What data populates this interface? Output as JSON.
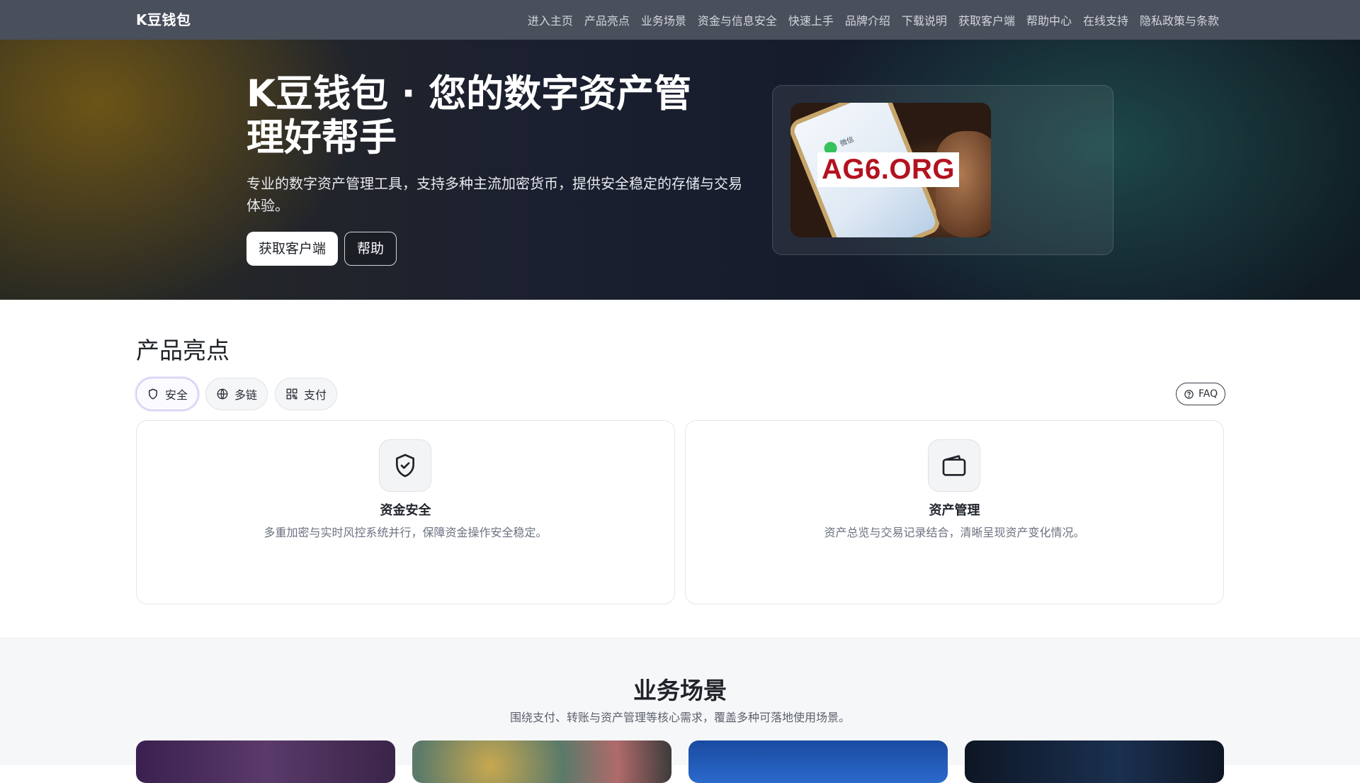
{
  "nav": {
    "brand": "K豆钱包",
    "links": [
      "进入主页",
      "产品亮点",
      "业务场景",
      "资金与信息安全",
      "快速上手",
      "品牌介绍",
      "下载说明",
      "获取客户端",
      "帮助中心",
      "在线支持",
      "隐私政策与条款"
    ]
  },
  "hero": {
    "title": "K豆钱包 · 您的数字资产管理好帮手",
    "subtitle": "专业的数字资产管理工具，支持多种主流加密货币，提供安全稳定的存储与交易体验。",
    "primary_button": "获取客户端",
    "secondary_button": "帮助",
    "image_watermark": "AG6.ORG",
    "phone_label": "微信"
  },
  "highlights": {
    "title": "产品亮点",
    "chips": [
      {
        "label": "安全",
        "icon": "shield-icon"
      },
      {
        "label": "多链",
        "icon": "globe-icon"
      },
      {
        "label": "支付",
        "icon": "qr-icon"
      }
    ],
    "faq_label": "FAQ",
    "features": [
      {
        "name": "资金安全",
        "desc": "多重加密与实时风控系统并行，保障资金操作安全稳定。",
        "icon": "shield-check-icon"
      },
      {
        "name": "资产管理",
        "desc": "资产总览与交易记录结合，清晰呈现资产变化情况。",
        "icon": "wallet-icon"
      }
    ]
  },
  "scenes": {
    "title": "业务场景",
    "subtitle": "围绕支付、转账与资产管理等核心需求，覆盖多种可落地使用场景。"
  },
  "colors": {
    "nav_bg": "#4a4f5c",
    "accent_chip_border": "#c9c2f3",
    "watermark_red": "#b3121f"
  }
}
